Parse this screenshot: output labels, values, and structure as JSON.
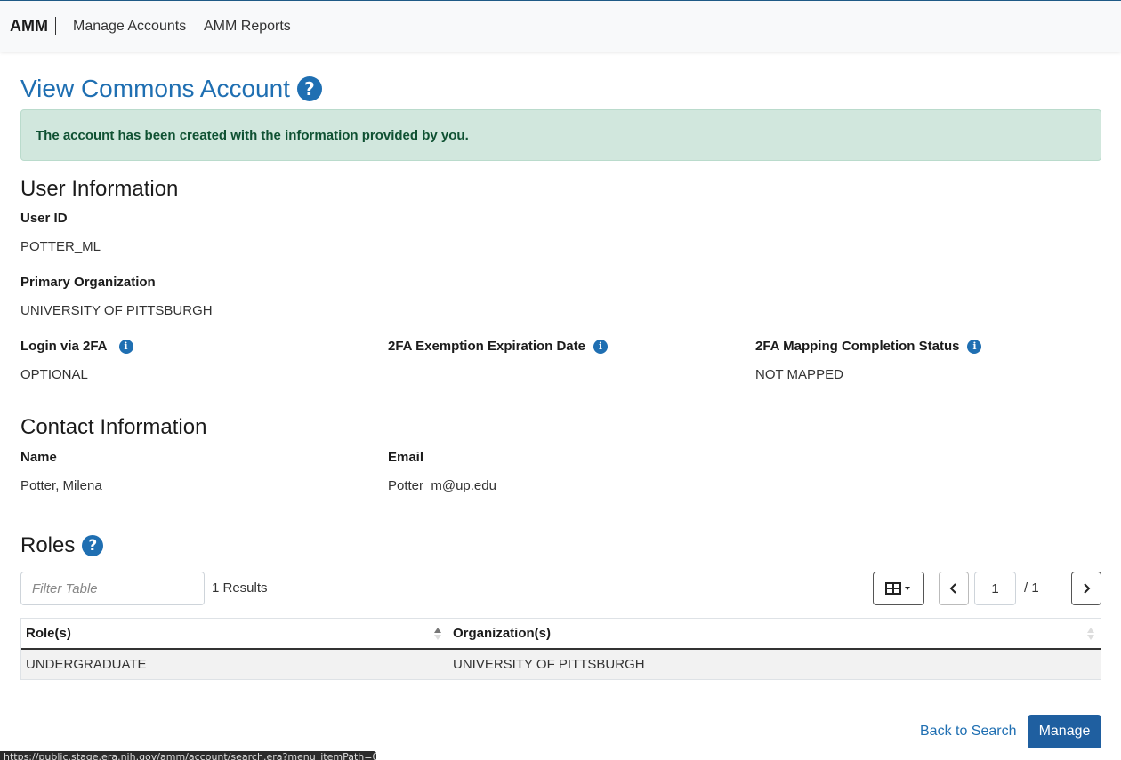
{
  "nav": {
    "brand": "AMM",
    "links": [
      "Manage Accounts",
      "AMM Reports"
    ]
  },
  "page": {
    "title": "View Commons Account"
  },
  "alert": {
    "message": "The account has been created with the information provided by you."
  },
  "user_info": {
    "heading": "User Information",
    "user_id_label": "User ID",
    "user_id": "POTTER_ML",
    "primary_org_label": "Primary Organization",
    "primary_org": "UNIVERSITY OF PITTSBURGH",
    "login_2fa_label": "Login via 2FA",
    "login_2fa": "OPTIONAL",
    "exemption_label": "2FA Exemption Expiration Date",
    "exemption": "",
    "mapping_label": "2FA Mapping Completion Status",
    "mapping": "NOT MAPPED"
  },
  "contact": {
    "heading": "Contact Information",
    "name_label": "Name",
    "name": "Potter, Milena",
    "email_label": "Email",
    "email": "Potter_m@up.edu"
  },
  "roles": {
    "heading": "Roles",
    "filter_placeholder": "Filter Table",
    "results": "1 Results",
    "page_current": "1",
    "page_total": "/ 1",
    "columns": [
      "Role(s)",
      "Organization(s)"
    ],
    "rows": [
      [
        "UNDERGRADUATE",
        "UNIVERSITY OF PITTSBURGH"
      ]
    ]
  },
  "footer": {
    "back_label": "Back to Search",
    "manage_label": "Manage"
  },
  "status_url": "https://public.stage.era.nih.gov/amm/account/search.era?menu_itemPath=03...",
  "colors": {
    "accent": "#1f6fb2",
    "alert_bg": "#d1e7dd",
    "alert_text": "#0f5132"
  }
}
